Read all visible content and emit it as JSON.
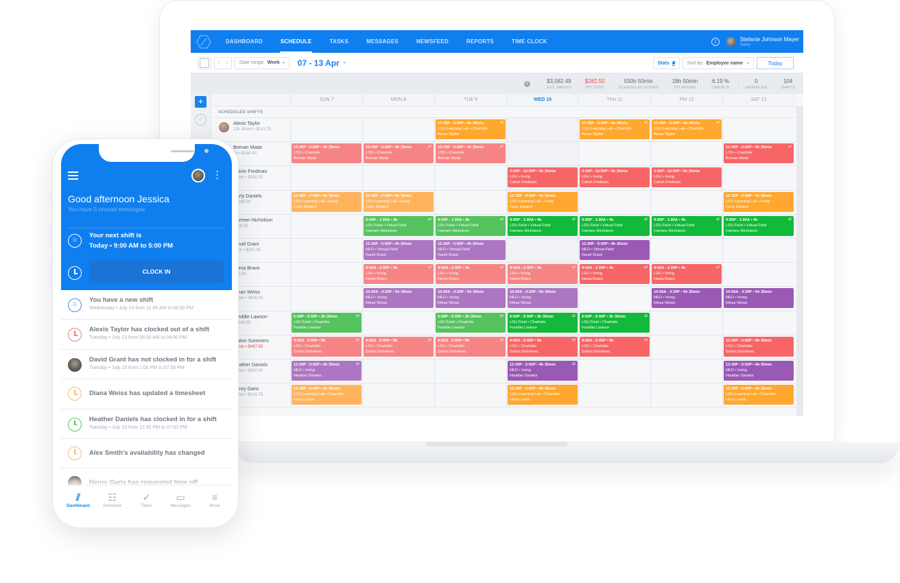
{
  "colors": {
    "brand": "#0f7ff0",
    "orange": "#ffa933",
    "red": "#f76c6c",
    "pink": "#f78585",
    "green": "#12b93a",
    "lightgreen": "#55c45f",
    "purple": "#9b59b6",
    "lightpurple": "#b07ac4"
  },
  "nav": {
    "items": [
      "DASHBOARD",
      "SCHEDULE",
      "TASKS",
      "MESSAGES",
      "NEWSFEED",
      "REPORTS",
      "TIME CLOCK"
    ],
    "active_index": 1,
    "user_name": "Stefanie Johnson Mayer",
    "user_location": "SoHo"
  },
  "toolbar": {
    "date_range_label": "Date range:",
    "date_range_value": "Week",
    "week_label": "07 - 13 Apr",
    "stats_label": "Stats",
    "sort_label": "Sort by:",
    "sort_value": "Employee name",
    "today_label": "Today"
  },
  "summary": [
    {
      "value": "$3,582.49",
      "label": "EST. WAGES"
    },
    {
      "value": "$282.50",
      "label": "O/T COST",
      "alert": true
    },
    {
      "value": "550h 50min",
      "label": "SCHEDULED HOURS"
    },
    {
      "value": "18h 50min",
      "label": "O/T HOURS"
    },
    {
      "value": "6.19 %",
      "label": "LABOR %"
    },
    {
      "value": "0",
      "label": "ABSENCES"
    },
    {
      "value": "104",
      "label": "SHIFTS"
    }
  ],
  "days": [
    "SUN 7",
    "MON 8",
    "TUE 9",
    "WED 10",
    "THU 11",
    "FRI 12",
    "SAT 13"
  ],
  "today_index": 3,
  "section_label": "SCHEDULED SHIFTS",
  "employees": [
    {
      "name": "Alexis Taylor",
      "meta": "13h 30min • $141.75",
      "shifts": [
        null,
        null,
        {
          "t": "12:30P - 5:00P • 4h 30min",
          "l": "LDU Learning Lab • Charlotte",
          "n": "Alexis Taylor",
          "c": "orange",
          "sw": true
        },
        null,
        {
          "t": "12:30P - 5:00P • 4h 30min",
          "l": "LDU Learning Lab • Charlotte",
          "n": "Alexis Taylor",
          "c": "orange",
          "sw": true
        },
        {
          "t": "12:30P - 5:00P • 4h 30min",
          "l": "LDU Learning Lab • Charlotte",
          "n": "Alexis Taylor",
          "c": "orange",
          "sw": true
        },
        null
      ]
    },
    {
      "name": "Brenan Matar",
      "meta": "?h • $180.00",
      "shifts": [
        {
          "t": "12:30P - 5:00P • 4h 30min",
          "l": "LDU • Charlotte",
          "n": "Brenan Matar",
          "c": "pink"
        },
        {
          "t": "12:30P - 5:00P • 4h 30min",
          "l": "LDU • Charlotte",
          "n": "Brenan Matar",
          "c": "pink",
          "sw": true
        },
        {
          "t": "12:30P - 5:00P • 4h 30min",
          "l": "LDU • Charlotte",
          "n": "Brenan Matar",
          "c": "pink",
          "sw": true
        },
        null,
        null,
        null,
        {
          "t": "12:30P - 5:00P • 4h 30min",
          "l": "LDU • Charlotte",
          "n": "Brenan Matar",
          "c": "red",
          "sw": true
        }
      ]
    },
    {
      "name": "Calvin Fredman",
      "meta": "30min • $292.50",
      "shifts": [
        null,
        null,
        null,
        {
          "t": "3:30P - 10:00P • 6h 30min",
          "l": "LDU • Irving",
          "n": "Calvin Fredman",
          "c": "red"
        },
        {
          "t": "3:30P - 10:00P • 6h 30min",
          "l": "LDU • Irving",
          "n": "Calvin Fredman",
          "c": "red"
        },
        {
          "t": "3:30P - 10:00P • 6h 30min",
          "l": "LDU • Irving",
          "n": "Calvin Fredman",
          "c": "red"
        },
        null
      ]
    },
    {
      "name": "Carly Daniels",
      "meta": "• $189.00",
      "shifts": [
        {
          "t": "12:30P - 5:00P • 4h 30min",
          "l": "LDU Learning Lab • Irving",
          "n": "Carly Daniels",
          "c": "lightorange"
        },
        {
          "t": "12:30P - 5:00P • 4h 30min",
          "l": "LDU Learning Lab • Irving",
          "n": "Carly Daniels",
          "c": "lightorange"
        },
        null,
        {
          "t": "12:30P - 5:00P • 4h 30min",
          "l": "LDU Learning Lab • Irving",
          "n": "Carly Daniels",
          "c": "orange"
        },
        null,
        null,
        {
          "t": "12:30P - 5:00P • 4h 30min",
          "l": "LDU Learning Lab • Irving",
          "n": "Carly Daniels",
          "c": "orange"
        }
      ]
    },
    {
      "name": "Carmen Nicholson",
      "meta": "$216.00",
      "shifts": [
        null,
        {
          "t": "9:00P - 1:00A • 4h",
          "l": "LDU Field • Virtual Field",
          "n": "Carmen Nicholson",
          "c": "lightgreen",
          "sw": true
        },
        {
          "t": "9:00P - 1:00A • 4h",
          "l": "LDU Field • Virtual Field",
          "n": "Carmen Nicholson",
          "c": "lightgreen",
          "sw": true
        },
        {
          "t": "9:00P - 1:00A • 4h",
          "l": "LDU Field • Virtual Field",
          "n": "Carmen Nicholson",
          "c": "green",
          "sw": true
        },
        {
          "t": "9:00P - 1:00A • 4h",
          "l": "LDU Field • Virtual Field",
          "n": "Carmen Nicholson",
          "c": "green",
          "sw": true
        },
        {
          "t": "9:00P - 1:00A • 4h",
          "l": "LDU Field • Virtual Field",
          "n": "Carmen Nicholson",
          "c": "green",
          "sw": true
        },
        {
          "t": "9:00P - 1:00A • 4h",
          "l": "LDU Field • Virtual Field",
          "n": "Carmen Nicholson",
          "c": "green",
          "sw": true
        }
      ]
    },
    {
      "name": "David Grant",
      "meta": "0min • $297.00",
      "shifts": [
        null,
        {
          "t": "12:30P - 5:00P • 4h 30min",
          "l": "NEO • Virtual Field",
          "n": "David Grant",
          "c": "lightpurple"
        },
        {
          "t": "12:30P - 5:00P • 4h 30min",
          "l": "NEO • Virtual Field",
          "n": "David Grant",
          "c": "lightpurple"
        },
        null,
        {
          "t": "12:30P - 5:00P • 4h 30min",
          "l": "NEO • Virtual Field",
          "n": "David Grant",
          "c": "purple"
        },
        null,
        null
      ]
    },
    {
      "name": "Diana Bravo",
      "meta": "• $0.00",
      "shifts": [
        null,
        {
          "t": "9:00A - 1:00P • 4h",
          "l": "LDU • Irving",
          "n": "Diana Bravo",
          "c": "pink",
          "sw": true
        },
        {
          "t": "9:00A - 1:00P • 4h",
          "l": "LDU • Irving",
          "n": "Diana Bravo",
          "c": "pink",
          "sw": true
        },
        {
          "t": "9:00A - 1:00P • 4h",
          "l": "LDU • Irving",
          "n": "Diana Bravo",
          "c": "pink",
          "sw": true
        },
        {
          "t": "9:00A - 1:00P • 4h",
          "l": "LDU • Irving",
          "n": "Diana Bravo",
          "c": "red",
          "sw": true
        },
        {
          "t": "9:00A - 1:00P • 4h",
          "l": "LDU • Irving",
          "n": "Diana Bravo",
          "c": "red",
          "sw": true
        },
        null
      ]
    },
    {
      "name": "Ethan Weiss",
      "meta": "30min • $605.00",
      "shifts": [
        null,
        {
          "t": "10:00A - 3:30P • 5h 30min",
          "l": "NEO • Irving",
          "n": "Ethan Weiss",
          "c": "lightpurple"
        },
        {
          "t": "10:00A - 3:30P • 5h 30min",
          "l": "NEO • Irving",
          "n": "Ethan Weiss",
          "c": "lightpurple"
        },
        {
          "t": "10:00A - 3:30P • 5h 30min",
          "l": "NEO • Irving",
          "n": "Ethan Weiss",
          "c": "lightpurple"
        },
        null,
        {
          "t": "10:00A - 3:30P • 5h 30min",
          "l": "NEO • Irving",
          "n": "Ethan Weiss",
          "c": "purple"
        },
        {
          "t": "10:00A - 3:30P • 5h 30min",
          "l": "NEO • Irving",
          "n": "Ethan Weiss",
          "c": "purple"
        }
      ]
    },
    {
      "name": "Freddie Lawson",
      "meta": "• $140.00",
      "shifts": [
        {
          "t": "6:00P - 9:30P • 3h 30min",
          "l": "LDU Field • Charlotte",
          "n": "Freddie Lawson",
          "c": "lightgreen",
          "sw": true
        },
        null,
        {
          "t": "6:00P - 9:30P • 3h 30min",
          "l": "LDU Field • Charlotte",
          "n": "Freddie Lawson",
          "c": "lightgreen",
          "sw": true
        },
        {
          "t": "6:00P - 9:30P • 3h 30min",
          "l": "LDU Field • Charlotte",
          "n": "Freddie Lawson",
          "c": "green",
          "sw": true
        },
        {
          "t": "6:00P - 9:30P • 3h 30min",
          "l": "LDU Field • Charlotte",
          "n": "Freddie Lawson",
          "c": "green",
          "sw": true
        },
        null,
        null
      ]
    },
    {
      "name": "Galvin Summers",
      "meta": "30min • $467.50",
      "meta_alert": true,
      "shifts": [
        {
          "t": "9:00A - 5:00P • 8h",
          "l": "LDU • Charlotte",
          "n": "Galvin Summers",
          "c": "pink",
          "sw": true
        },
        {
          "t": "9:00A - 5:00P • 8h",
          "l": "LDU • Charlotte",
          "n": "Galvin Summers",
          "c": "pink",
          "sw": true
        },
        {
          "t": "9:00A - 5:00P • 8h",
          "l": "LDU • Charlotte",
          "n": "Galvin Summers",
          "c": "pink",
          "sw": true
        },
        {
          "t": "9:00A - 5:00P • 8h",
          "l": "LDU • Charlotte",
          "n": "Galvin Summers",
          "c": "red",
          "sw": true
        },
        {
          "t": "9:00A - 5:00P • 8h",
          "l": "LDU • Charlotte",
          "n": "Galvin Summers",
          "c": "red",
          "sw": true
        },
        null,
        {
          "t": "12:30P - 5:00P • 4h 30min",
          "l": "LDU • Charlotte",
          "n": "Galvin Summers",
          "c": "red"
        }
      ]
    },
    {
      "name": "Heather Daniels",
      "meta": "30min • $297.00",
      "shifts": [
        {
          "t": "12:30P - 5:00P • 4h 30min",
          "l": "NEO • Irving",
          "n": "Heather Daniels",
          "c": "lightpurple",
          "sw": true
        },
        null,
        null,
        {
          "t": "12:30P - 5:00P • 4h 30min",
          "l": "NEO • Irving",
          "n": "Heather Daniels",
          "c": "purple",
          "sw": true
        },
        null,
        null,
        {
          "t": "12:30P - 5:00P • 4h 30min",
          "l": "NEO • Irving",
          "n": "Heather Daniels",
          "c": "purple"
        }
      ]
    },
    {
      "name": "Henry Garix",
      "meta": "30min • $141.75",
      "shifts": [
        {
          "t": "12:30P - 5:00P • 4h 30min",
          "l": "LDU Learning Lab • Charlotte",
          "n": "Henry Garix",
          "c": "lightorange"
        },
        null,
        null,
        {
          "t": "12:30P - 5:00P • 4h 30min",
          "l": "LDU Learning Lab • Charlotte",
          "n": "Henry Garix",
          "c": "orange"
        },
        null,
        null,
        {
          "t": "12:30P - 5:00P • 4h 30min",
          "l": "LDU Learning Lab • Charlotte",
          "n": "Henry Garix",
          "c": "orange"
        }
      ]
    }
  ],
  "phone": {
    "greeting": "Good afternoon Jessica",
    "unread": "You have 5 unread messages",
    "next_shift_line1": "Your next shift is",
    "next_shift_line2": "Today • 9:00 AM to 5:00 PM",
    "clock_in_label": "CLOCK IN",
    "feed": [
      {
        "icon": "calendar",
        "color": "#3d8ef0",
        "title": "You have a new shift",
        "sub": "Wednesday • July 24 from 11:00 AM to 06:00 PM"
      },
      {
        "icon": "clock",
        "color": "#f07e7e",
        "title": "Alexis Taylor has clocked out of a shift",
        "sub": "Tuesday • July 23 from 08:00 AM to 04:00 PM"
      },
      {
        "icon": "avatar",
        "color": "#333",
        "title": "David Grant has not clocked in for a shift",
        "sub": "Tuesday • July 23 from 1:00 PM to 07:00 PM"
      },
      {
        "icon": "clock",
        "color": "#f5bd72",
        "title": "Diana Weiss has updated a timesheet",
        "sub": ""
      },
      {
        "icon": "clock",
        "color": "#4cc763",
        "title": "Heather Daniels has clocked in for a shift",
        "sub": "Tuesday • July 23 from 12:30 PM to 07:00 PM"
      },
      {
        "icon": "clock",
        "color": "#f5bd72",
        "title": "Alex Smith’s availability has changed",
        "sub": ""
      },
      {
        "icon": "avatar",
        "color": "#333",
        "title": "Henry Garix has requested time off",
        "sub": ""
      }
    ],
    "tabs": [
      {
        "label": "Dashboard",
        "glyph": "⫽",
        "active": true
      },
      {
        "label": "Schedule",
        "glyph": "☷"
      },
      {
        "label": "Tasks",
        "glyph": "✓"
      },
      {
        "label": "Messages",
        "glyph": "▭"
      },
      {
        "label": "More",
        "glyph": "≡"
      }
    ]
  }
}
